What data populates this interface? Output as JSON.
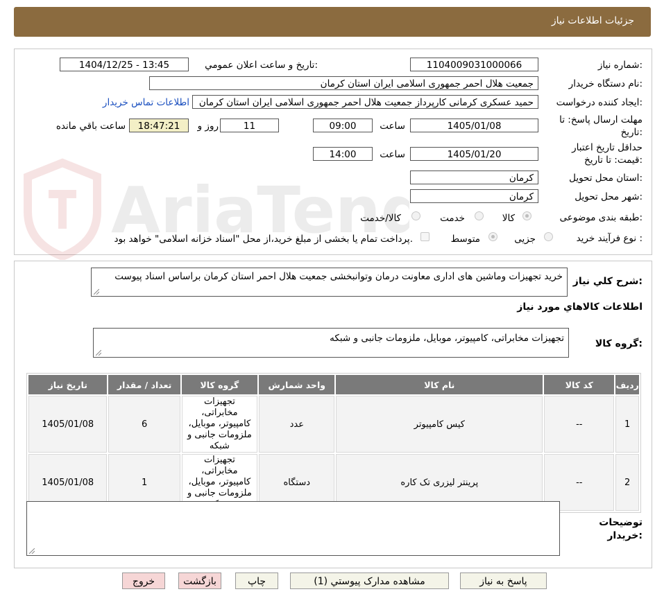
{
  "header": {
    "title": "جزئیات اطلاعات نیاز"
  },
  "form": {
    "need_number_label": "شماره نیاز:",
    "need_number": "1104009031000066",
    "announce_label": "تاریخ و ساعت اعلان عمومي:",
    "announce_value": "1404/12/25 - 13:45",
    "buyer_org_label": "نام دستگاه خريدار:",
    "buyer_org": "جمعیت هلال احمر جمهوری اسلامی ایران استان کرمان",
    "requester_label": "ايجاد کننده درخواست:",
    "requester": "حمید عسکری کرمانی کارپرداز جمعیت هلال احمر جمهوری اسلامی ایران استان کرمان",
    "contact_link": "اطلاعات تماس خريدار",
    "reply_deadline_label_1": "مهلت ارسال پاسخ: تا",
    "reply_deadline_label_2": "تاريخ:",
    "reply_date": "1405/01/08",
    "time_label": "ساعت",
    "reply_time": "09:00",
    "days_value": "11",
    "days_label": "روز و",
    "remaining_time": "18:47:21",
    "remaining_label": "ساعت باقي مانده",
    "validity_label_1": "حداقل تاريخ اعتبار",
    "validity_label_2": "قيمت: تا تاريخ:",
    "validity_date": "1405/01/20",
    "validity_time_label": "ساعت",
    "validity_time": "14:00",
    "province_label": "استان محل تحويل:",
    "province": "کرمان",
    "city_label": "شهر محل تحويل:",
    "city": "کرمان",
    "category_label": "طبقه بندی موضوعی:",
    "category_options": [
      "کالا",
      "خدمت",
      "کالا/خدمت"
    ],
    "category_selected": "کالا",
    "process_label": "نوع فرآیند خرید :",
    "process_options": [
      "جزیی",
      "متوسط"
    ],
    "process_selected": "متوسط",
    "payment_note": "پرداخت تمام یا بخشی از مبلغ خرید،از محل \"اسناد خزانه اسلامی\" خواهد بود."
  },
  "description": {
    "label": "شرح کلي نياز:",
    "text": "خرید تجهیزات وماشین های اداری معاونت درمان وتوانبخشی  جمعیت هلال احمر استان کرمان براساس اسناد پیوست"
  },
  "goods": {
    "section_title": "اطلاعات کالاهاي مورد نياز",
    "group_label": "گروه کالا:",
    "group_value": "تجهیزات مخابراتی، کامپیوتر، موبایل، ملزومات جانبی و شبکه",
    "table": {
      "headers": [
        "رديف",
        "کد کالا",
        "نام کالا",
        "واحد شمارش",
        "گروه کالا",
        "تعداد / مقدار",
        "تاريخ نياز"
      ],
      "rows": [
        {
          "row": "1",
          "code": "--",
          "name": "کیس کامپیوتر",
          "unit": "عدد",
          "group": "تجهیزات مخابراتی، کامپیوتر، موبایل، ملزومات جانبی و شبکه",
          "qty": "6",
          "date": "1405/01/08"
        },
        {
          "row": "2",
          "code": "--",
          "name": "پرینتر لیزری تک کاره",
          "unit": "دستگاه",
          "group": "تجهیزات مخابراتی، کامپیوتر، موبایل، ملزومات جانبی و شبکه",
          "qty": "1",
          "date": "1405/01/08"
        }
      ]
    }
  },
  "buyer_notes": {
    "label_1": "توضيحات",
    "label_2": "خريدار:",
    "text": ""
  },
  "buttons": {
    "reply": "پاسخ به نیاز",
    "attachments": "مشاهده مدارک پیوستي (1)",
    "print": "چاپ",
    "back": "بازگشت",
    "exit": "خروج"
  },
  "watermark": {
    "text": "AriaTender.neT"
  },
  "icons": {
    "resize_grip": "resize-grip-icon",
    "watermark_logo": "shield-logo-icon"
  }
}
